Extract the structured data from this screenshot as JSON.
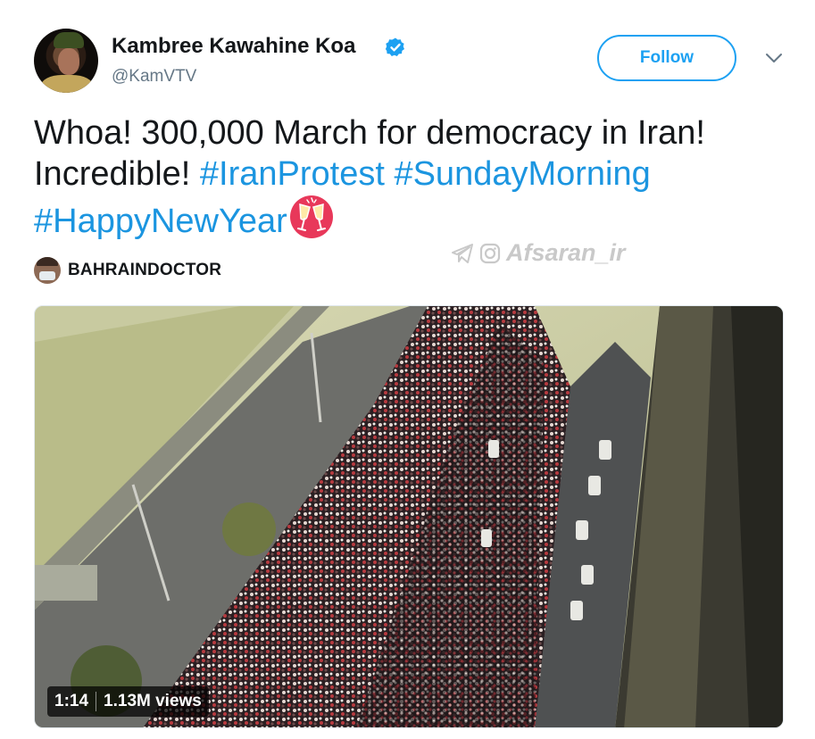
{
  "author": {
    "name": "Kambree Kawahine Koa",
    "handle": "@KamVTV",
    "verified_icon": "verified-badge-icon",
    "accent": "#1da1f2"
  },
  "follow_label": "Follow",
  "tweet": {
    "text_line1": "Whoa! 300,000 March for democracy in Iran!",
    "text_line2_prefix": "Incredible!",
    "hashtags": [
      "#IranProtest",
      "#SundayMorning",
      "#HappyNewYear"
    ],
    "emoji": "clinking-glasses-icon"
  },
  "watermark": "Afsaran_ir",
  "source": {
    "name": "BAHRAINDOCTOR"
  },
  "video": {
    "duration": "1:14",
    "views": "1.13M views"
  }
}
